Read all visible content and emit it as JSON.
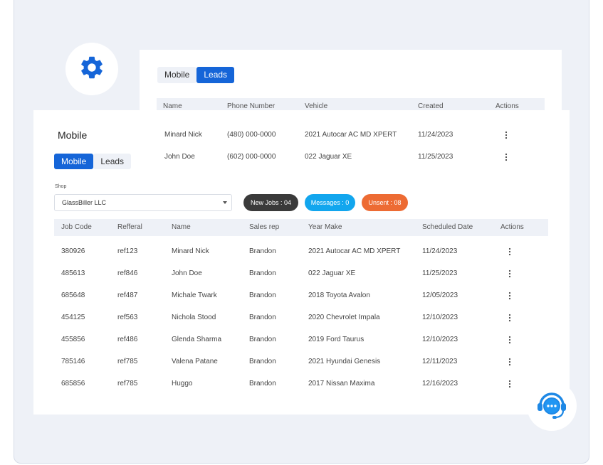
{
  "colors": {
    "accent": "#1565d8",
    "background": "#eef1f7",
    "dark_pill": "#3a3a3a",
    "blue_pill": "#12a6ee",
    "orange_pill": "#ed6b33"
  },
  "icons": {
    "settings": "gear-icon",
    "support": "headset-chat-icon",
    "row_actions": "kebab-menu-icon"
  },
  "leads": {
    "tabs": [
      {
        "label": "Mobile",
        "active": false
      },
      {
        "label": "Leads",
        "active": true
      }
    ],
    "columns": [
      "Name",
      "Phone Number",
      "Vehicle",
      "Created",
      "Actions"
    ],
    "rows": [
      {
        "name": "Minard Nick",
        "phone": "(480) 000-0000",
        "vehicle": "2021 Autocar AC MD XPERT",
        "created": "11/24/2023"
      },
      {
        "name": "John Doe",
        "phone": "(602) 000-0000",
        "vehicle": "022 Jaguar XE",
        "created": "11/25/2023"
      }
    ]
  },
  "main": {
    "title": "Mobile",
    "tabs": [
      {
        "label": "Mobile",
        "active": true
      },
      {
        "label": "Leads",
        "active": false
      }
    ],
    "shop": {
      "label": "Shop",
      "value": "GlassBiller LLC"
    },
    "pills": {
      "new_jobs": "New Jobs : 04",
      "messages": "Messages : 0",
      "unsent": "Unsent : 08"
    },
    "columns": [
      "Job Code",
      "Refferal",
      "Name",
      "Sales rep",
      "Year Make",
      "Scheduled Date",
      "Actions"
    ],
    "rows": [
      {
        "job_code": "380926",
        "referral": "ref123",
        "name": "Minard Nick",
        "sales_rep": "Brandon",
        "year_make": "2021 Autocar AC MD XPERT",
        "scheduled": "11/24/2023"
      },
      {
        "job_code": "485613",
        "referral": "ref846",
        "name": "John Doe",
        "sales_rep": "Brandon",
        "year_make": "022 Jaguar XE",
        "scheduled": "11/25/2023"
      },
      {
        "job_code": "685648",
        "referral": "ref487",
        "name": "Michale Twark",
        "sales_rep": "Brandon",
        "year_make": "2018 Toyota Avalon",
        "scheduled": "12/05/2023"
      },
      {
        "job_code": "454125",
        "referral": "ref563",
        "name": "Nichola Stood",
        "sales_rep": "Brandon",
        "year_make": "2020 Chevrolet Impala",
        "scheduled": "12/10/2023"
      },
      {
        "job_code": "455856",
        "referral": "ref486",
        "name": "Glenda Sharma",
        "sales_rep": "Brandon",
        "year_make": "2019 Ford Taurus",
        "scheduled": "12/10/2023"
      },
      {
        "job_code": "785146",
        "referral": "ref785",
        "name": "Valena Patane",
        "sales_rep": "Brandon",
        "year_make": "2021 Hyundai Genesis",
        "scheduled": "12/11/2023"
      },
      {
        "job_code": "685856",
        "referral": "ref785",
        "name": "Huggo",
        "sales_rep": "Brandon",
        "year_make": "2017 Nissan Maxima",
        "scheduled": "12/16/2023"
      }
    ]
  }
}
